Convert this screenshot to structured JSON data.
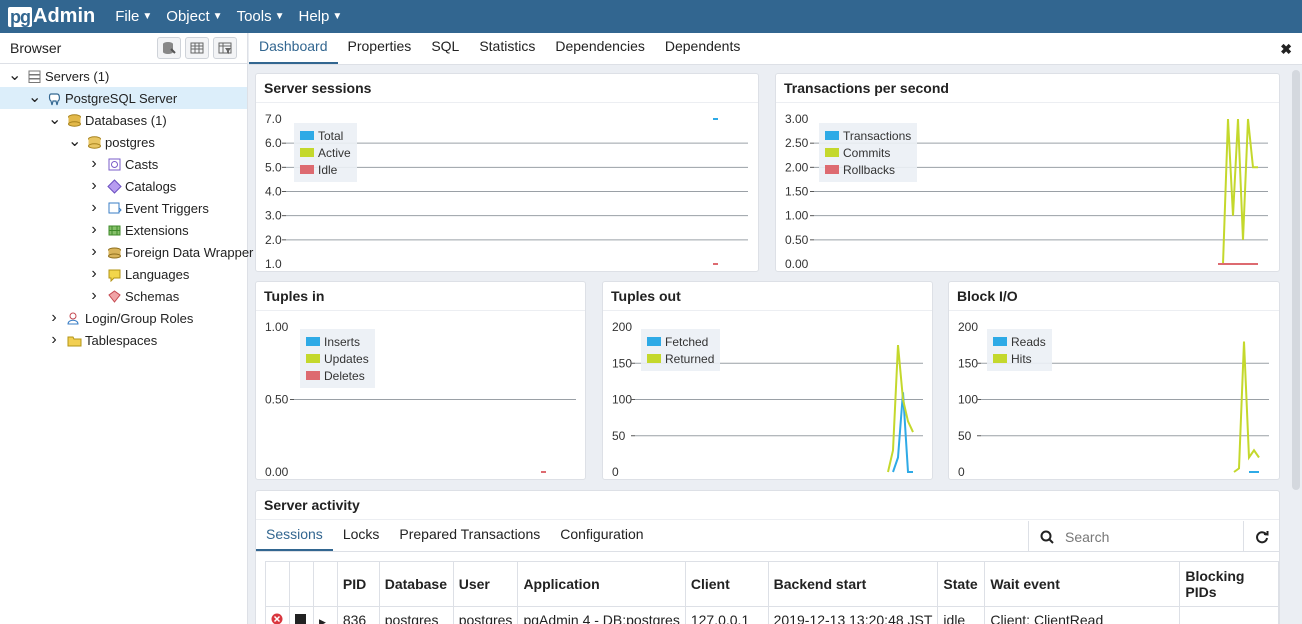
{
  "app": {
    "logo_pg": "pg",
    "logo_admin": "Admin"
  },
  "menu": [
    {
      "label": "File"
    },
    {
      "label": "Object"
    },
    {
      "label": "Tools"
    },
    {
      "label": "Help"
    }
  ],
  "browser": {
    "title": "Browser",
    "tree": [
      {
        "label": "Servers (1)",
        "toggle": "expanded",
        "icon": "servers-icon"
      },
      {
        "label": "PostgreSQL Server",
        "toggle": "expanded",
        "icon": "elephant-icon"
      },
      {
        "label": "Databases (1)",
        "toggle": "expanded",
        "icon": "databases-icon"
      },
      {
        "label": "postgres",
        "toggle": "expanded",
        "icon": "database-icon"
      },
      {
        "label": "Casts",
        "toggle": "collapsed",
        "icon": "casts-icon"
      },
      {
        "label": "Catalogs",
        "toggle": "collapsed",
        "icon": "catalogs-icon"
      },
      {
        "label": "Event Triggers",
        "toggle": "collapsed",
        "icon": "event-triggers-icon"
      },
      {
        "label": "Extensions",
        "toggle": "collapsed",
        "icon": "extensions-icon"
      },
      {
        "label": "Foreign Data Wrapper",
        "toggle": "collapsed",
        "icon": "foreign-data-wrapper-icon"
      },
      {
        "label": "Languages",
        "toggle": "collapsed",
        "icon": "languages-icon"
      },
      {
        "label": "Schemas",
        "toggle": "collapsed",
        "icon": "schemas-icon"
      },
      {
        "label": "Login/Group Roles",
        "toggle": "collapsed",
        "icon": "login-roles-icon"
      },
      {
        "label": "Tablespaces",
        "toggle": "collapsed",
        "icon": "tablespaces-icon"
      }
    ]
  },
  "tabs": [
    "Dashboard",
    "Properties",
    "SQL",
    "Statistics",
    "Dependencies",
    "Dependents"
  ],
  "colors": {
    "accent": "#326690",
    "blue": "#2eaae6",
    "green": "#c4d82c",
    "red": "#dd6a70"
  },
  "chart_data": [
    {
      "type": "line",
      "title": "Server sessions",
      "ylim": [
        1.0,
        7.0
      ],
      "ticks": [
        "7.0",
        "6.0",
        "5.0",
        "4.0",
        "3.0",
        "2.0",
        "1.0"
      ],
      "series": [
        {
          "name": "Total",
          "color": "#2eaae6",
          "values": [
            7,
            7
          ]
        },
        {
          "name": "Active",
          "color": "#c4d82c",
          "values": []
        },
        {
          "name": "Idle",
          "color": "#dd6a70",
          "values": [
            1,
            1
          ]
        }
      ]
    },
    {
      "type": "line",
      "title": "Transactions per second",
      "ylim": [
        0.0,
        3.0
      ],
      "ticks": [
        "3.00",
        "2.50",
        "2.00",
        "1.50",
        "1.00",
        "0.50",
        "0.00"
      ],
      "series": [
        {
          "name": "Transactions",
          "color": "#2eaae6",
          "values": []
        },
        {
          "name": "Commits",
          "color": "#c4d82c",
          "values": [
            0,
            0,
            3,
            1,
            3,
            0.5,
            3,
            2,
            2
          ]
        },
        {
          "name": "Rollbacks",
          "color": "#dd6a70",
          "values": [
            0,
            0,
            0,
            0,
            0,
            0,
            0,
            0,
            0
          ]
        }
      ]
    },
    {
      "type": "line",
      "title": "Tuples in",
      "ylim": [
        0.0,
        1.0
      ],
      "ticks": [
        "1.00",
        "0.50",
        "0.00"
      ],
      "series": [
        {
          "name": "Inserts",
          "color": "#2eaae6",
          "values": []
        },
        {
          "name": "Updates",
          "color": "#c4d82c",
          "values": []
        },
        {
          "name": "Deletes",
          "color": "#dd6a70",
          "values": [
            0,
            0
          ]
        }
      ]
    },
    {
      "type": "line",
      "title": "Tuples out",
      "ylim": [
        0,
        200
      ],
      "ticks": [
        "200",
        "150",
        "100",
        "50",
        "0"
      ],
      "series": [
        {
          "name": "Fetched",
          "color": "#2eaae6",
          "values": [
            0,
            20,
            110,
            0,
            0
          ]
        },
        {
          "name": "Returned",
          "color": "#c4d82c",
          "values": [
            0,
            30,
            175,
            100,
            70,
            55
          ]
        }
      ]
    },
    {
      "type": "line",
      "title": "Block I/O",
      "ylim": [
        0,
        200
      ],
      "ticks": [
        "200",
        "150",
        "100",
        "50",
        "0"
      ],
      "series": [
        {
          "name": "Reads",
          "color": "#2eaae6",
          "values": [
            0,
            0,
            0
          ]
        },
        {
          "name": "Hits",
          "color": "#c4d82c",
          "values": [
            0,
            5,
            180,
            20,
            30,
            20
          ]
        }
      ]
    }
  ],
  "activity": {
    "title": "Server activity",
    "tabs": [
      "Sessions",
      "Locks",
      "Prepared Transactions",
      "Configuration"
    ],
    "search_placeholder": "Search",
    "columns": [
      "",
      "",
      "",
      "PID",
      "Database",
      "User",
      "Application",
      "Client",
      "Backend start",
      "State",
      "Wait event",
      "Blocking PIDs"
    ],
    "rows": [
      [
        "836",
        "postgres",
        "postgres",
        "pgAdmin 4 - DB:postgres",
        "127.0.0.1",
        "2019-12-13 13:20:48 JST",
        "idle",
        "Client: ClientRead",
        ""
      ]
    ]
  }
}
